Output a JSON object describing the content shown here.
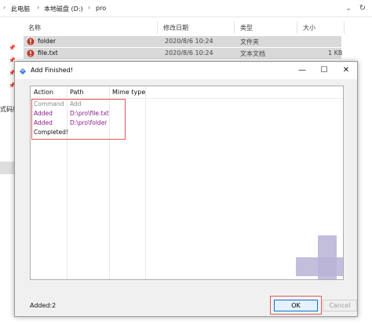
{
  "explorer": {
    "breadcrumb": [
      "此电脑",
      "本地磁盘 (D:)",
      "pro"
    ],
    "columns": {
      "name": "名称",
      "date": "修改日期",
      "type": "类型",
      "size": "大小"
    },
    "files": [
      {
        "name": "folder",
        "date": "2020/8/6 10:24",
        "type": "文件夹",
        "size": ""
      },
      {
        "name": "file.txt",
        "date": "2020/8/6 10:24",
        "type": "文本文档",
        "size": "1 KB"
      }
    ],
    "sidebar_partial_label": "式码版"
  },
  "dialog": {
    "title": "Add Finished!",
    "columns": {
      "action": "Action",
      "path": "Path",
      "mime": "Mime type"
    },
    "rows": [
      {
        "action": "Command",
        "path": "Add",
        "style": "gray"
      },
      {
        "action": "Added",
        "path": "D:\\pro\\file.txt",
        "style": "purple"
      },
      {
        "action": "Added",
        "path": "D:\\pro\\folder",
        "style": "purple"
      },
      {
        "action": "Completed!",
        "path": "",
        "style": "black"
      }
    ],
    "status": "Added:2",
    "ok_label": "OK",
    "cancel_label": "Cancel"
  },
  "colors": {
    "added": "#8b1a8b",
    "command": "#8a8a8a",
    "highlight": "#e05a5a",
    "ok_border": "#0078d7"
  }
}
